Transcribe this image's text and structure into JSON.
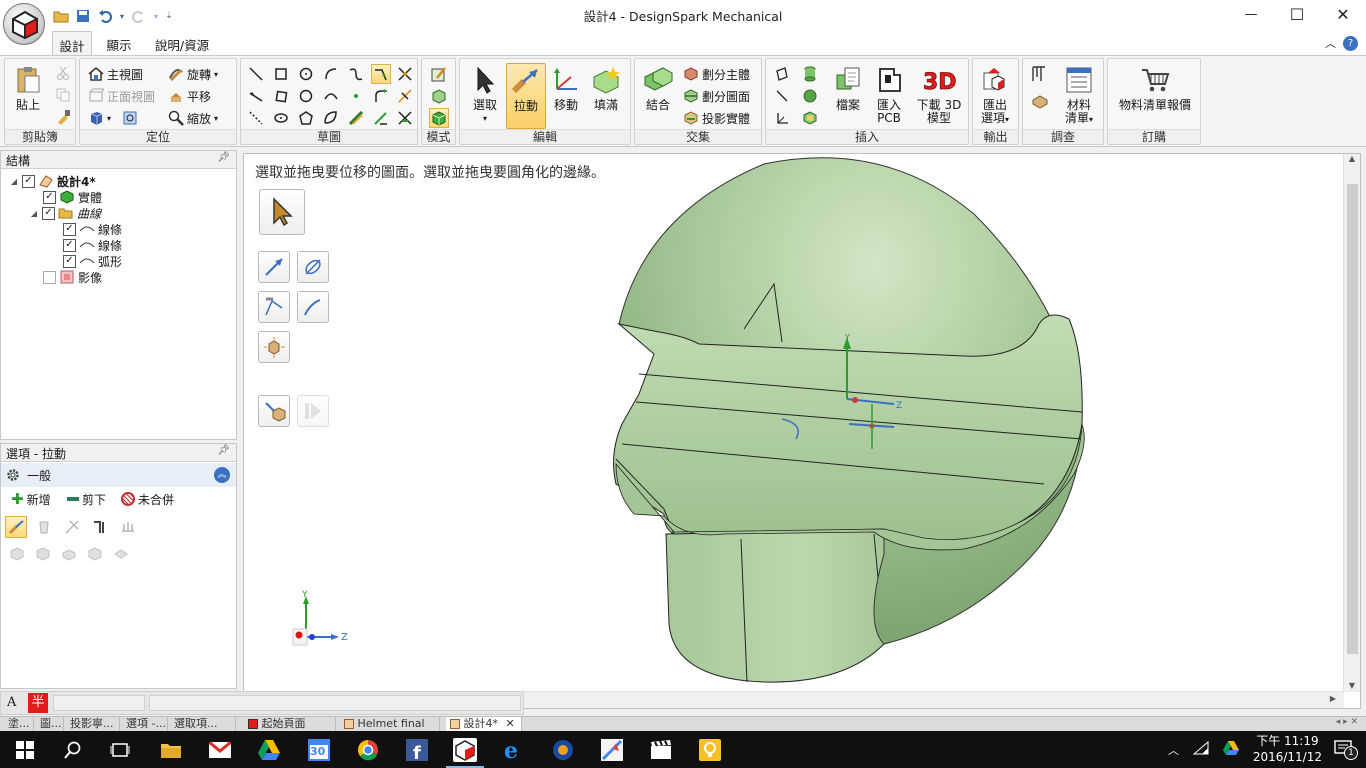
{
  "window": {
    "title": "設計4 - DesignSpark Mechanical",
    "controls": {
      "minimize": "—",
      "maximize": "☐",
      "close": "✕"
    }
  },
  "ribbon_tabs": [
    "設計",
    "顯示",
    "說明/資源"
  ],
  "ribbon_groups": {
    "clipboard": {
      "label": "剪貼簿",
      "paste": "貼上"
    },
    "orient": {
      "label": "定位",
      "home": "主視圖",
      "spin": "旋轉",
      "plan": "正面視圖",
      "pan": "平移",
      "zoom": "縮放"
    },
    "sketch": {
      "label": "草圖"
    },
    "mode": {
      "label": "模式"
    },
    "edit": {
      "label": "編輯",
      "select": "選取",
      "pull": "拉動",
      "move": "移動",
      "fill": "填滿"
    },
    "intersect": {
      "label": "交集",
      "combine": "結合",
      "split_body": "劃分主體",
      "split_face": "劃分圖面",
      "project": "投影實體"
    },
    "insert": {
      "label": "插入",
      "file": "檔案",
      "import_pcb_1": "匯入",
      "import_pcb_2": "PCB",
      "download_1": "下載 3D",
      "download_2": "模型"
    },
    "output": {
      "label": "輸出",
      "export_1": "匯出",
      "export_2": "選項"
    },
    "investigate": {
      "label": "調查",
      "bom_1": "材料",
      "bom_2": "清單"
    },
    "order": {
      "label": "訂購",
      "quote": "物料清單報價"
    }
  },
  "structure_panel": {
    "title": "結構",
    "items": [
      {
        "label": "設計4*",
        "checked": true,
        "bold": true
      },
      {
        "label": "實體",
        "checked": true
      },
      {
        "label": "曲線",
        "checked": true,
        "italic": true
      },
      {
        "label": "線條",
        "checked": true
      },
      {
        "label": "線條",
        "checked": true
      },
      {
        "label": "弧形",
        "checked": true
      },
      {
        "label": "影像",
        "checked": false
      }
    ]
  },
  "options_panel": {
    "title": "選項 - 拉動",
    "section": "一般",
    "add": "新增",
    "cut": "剪下",
    "no_merge": "未合併"
  },
  "viewport": {
    "hint": "選取並拖曳要位移的圖面。選取並拖曳要圓角化的邊緣。",
    "axis_y": "Y",
    "axis_z": "Z"
  },
  "status_strip": {
    "a": "A",
    "b": "半"
  },
  "doc_tabs": [
    "塗...",
    "圖...",
    "投影寧...",
    "選項 -...",
    "選取項...",
    "起始頁面",
    "Helmet final",
    "設計4*"
  ],
  "taskbar": {
    "time": "下午 11:19",
    "date": "2016/11/12",
    "calendar_day": "30",
    "notification_count": "1"
  },
  "colors": {
    "model_fill": "#b7d1a9",
    "model_shadow": "#8fb383",
    "accent_blue": "#2a63b0",
    "taskbar": "#101010"
  }
}
